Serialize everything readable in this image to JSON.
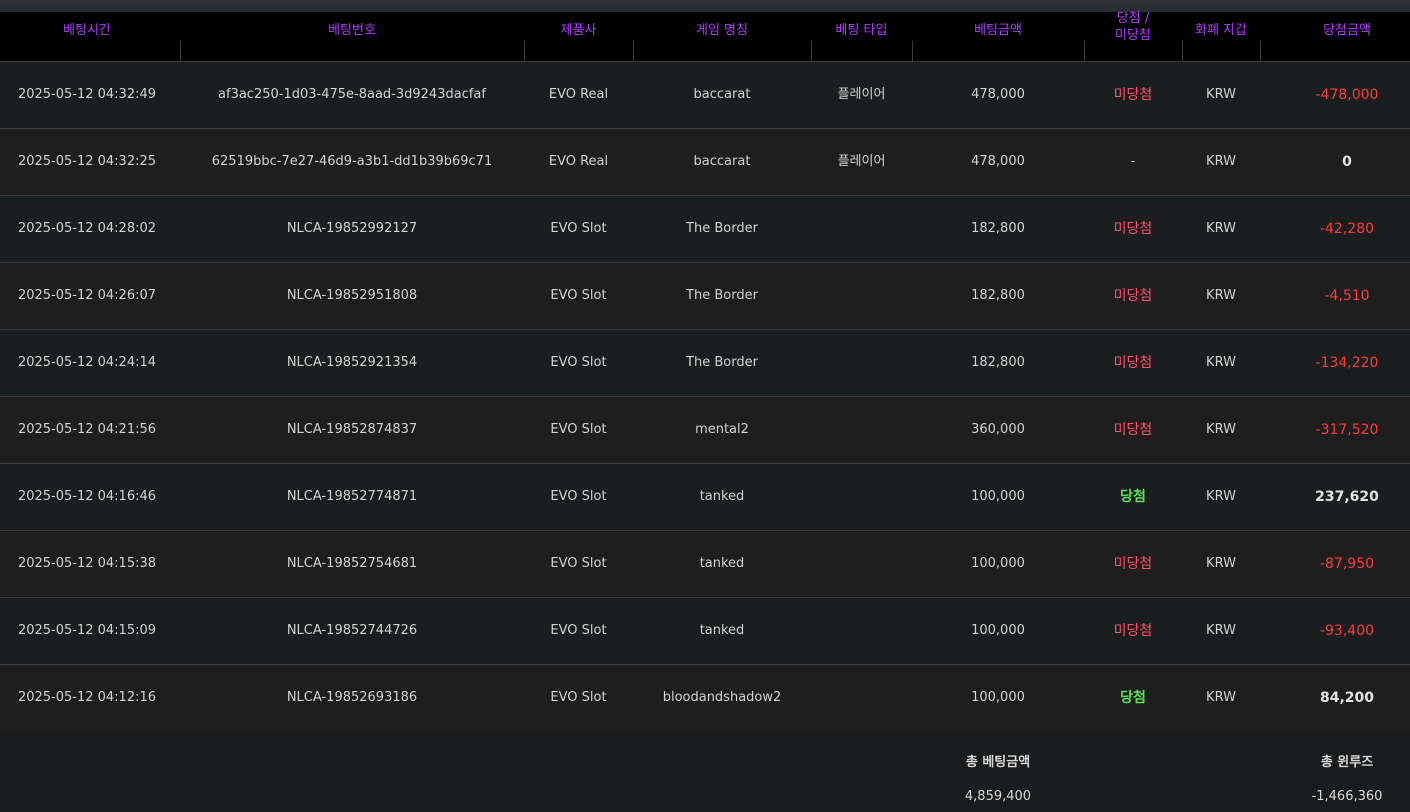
{
  "table": {
    "headers": {
      "bet_time": "베팅시간",
      "bet_id": "베팅번호",
      "vendor": "제품사",
      "game_name": "게임 명칭",
      "bet_type": "베팅 타입",
      "bet_amount": "베팅금액",
      "result_line1": "당첨 /",
      "result_line2": "미당첨",
      "currency": "화폐 지갑",
      "win_amount": "당첨금액"
    },
    "rows": [
      {
        "time": "2025-05-12 04:32:49",
        "id": "af3ac250-1d03-475e-8aad-3d9243dacfaf",
        "vendor": "EVO Real",
        "game": "baccarat",
        "type": "플레이어",
        "bet": "478,000",
        "result": "미당첨",
        "result_kind": "lose",
        "currency": "KRW",
        "win": "-478,000",
        "win_kind": "neg"
      },
      {
        "time": "2025-05-12 04:32:25",
        "id": "62519bbc-7e27-46d9-a3b1-dd1b39b69c71",
        "vendor": "EVO Real",
        "game": "baccarat",
        "type": "플레이어",
        "bet": "478,000",
        "result": "-",
        "result_kind": "none",
        "currency": "KRW",
        "win": "0",
        "win_kind": "pos"
      },
      {
        "time": "2025-05-12 04:28:02",
        "id": "NLCA-19852992127",
        "vendor": "EVO Slot",
        "game": "The Border",
        "type": "",
        "bet": "182,800",
        "result": "미당첨",
        "result_kind": "lose",
        "currency": "KRW",
        "win": "-42,280",
        "win_kind": "neg"
      },
      {
        "time": "2025-05-12 04:26:07",
        "id": "NLCA-19852951808",
        "vendor": "EVO Slot",
        "game": "The Border",
        "type": "",
        "bet": "182,800",
        "result": "미당첨",
        "result_kind": "lose",
        "currency": "KRW",
        "win": "-4,510",
        "win_kind": "neg"
      },
      {
        "time": "2025-05-12 04:24:14",
        "id": "NLCA-19852921354",
        "vendor": "EVO Slot",
        "game": "The Border",
        "type": "",
        "bet": "182,800",
        "result": "미당첨",
        "result_kind": "lose",
        "currency": "KRW",
        "win": "-134,220",
        "win_kind": "neg"
      },
      {
        "time": "2025-05-12 04:21:56",
        "id": "NLCA-19852874837",
        "vendor": "EVO Slot",
        "game": "mental2",
        "type": "",
        "bet": "360,000",
        "result": "미당첨",
        "result_kind": "lose",
        "currency": "KRW",
        "win": "-317,520",
        "win_kind": "neg"
      },
      {
        "time": "2025-05-12 04:16:46",
        "id": "NLCA-19852774871",
        "vendor": "EVO Slot",
        "game": "tanked",
        "type": "",
        "bet": "100,000",
        "result": "당첨",
        "result_kind": "win",
        "currency": "KRW",
        "win": "237,620",
        "win_kind": "pos"
      },
      {
        "time": "2025-05-12 04:15:38",
        "id": "NLCA-19852754681",
        "vendor": "EVO Slot",
        "game": "tanked",
        "type": "",
        "bet": "100,000",
        "result": "미당첨",
        "result_kind": "lose",
        "currency": "KRW",
        "win": "-87,950",
        "win_kind": "neg"
      },
      {
        "time": "2025-05-12 04:15:09",
        "id": "NLCA-19852744726",
        "vendor": "EVO Slot",
        "game": "tanked",
        "type": "",
        "bet": "100,000",
        "result": "미당첨",
        "result_kind": "lose",
        "currency": "KRW",
        "win": "-93,400",
        "win_kind": "neg"
      },
      {
        "time": "2025-05-12 04:12:16",
        "id": "NLCA-19852693186",
        "vendor": "EVO Slot",
        "game": "bloodandshadow2",
        "type": "",
        "bet": "100,000",
        "result": "당첨",
        "result_kind": "win",
        "currency": "KRW",
        "win": "84,200",
        "win_kind": "pos"
      }
    ]
  },
  "totals": {
    "bet_label": "총 베팅금액",
    "bet_value": "4,859,400",
    "winloss_label": "총 윈루즈",
    "winloss_value": "-1,466,360"
  },
  "colors": {
    "header_text": "#b23bff",
    "lose_status": "#ff4f6e",
    "win_status": "#5ee05e",
    "negative_amount": "#ff3a3a"
  }
}
